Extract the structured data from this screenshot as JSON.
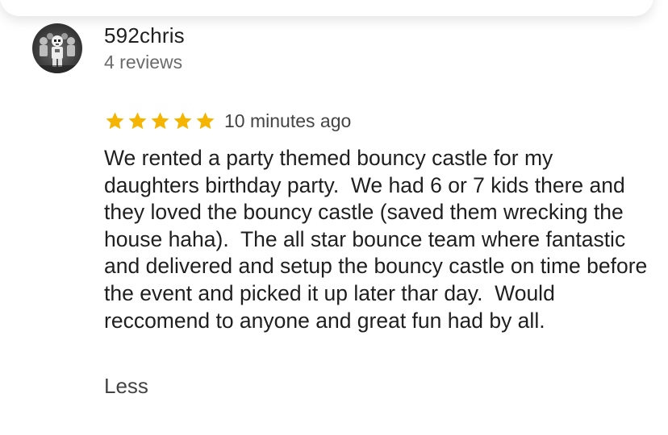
{
  "review": {
    "author_name": "592chris",
    "review_count": "4 reviews",
    "rating": 5,
    "rating_max": 5,
    "time_ago": "10 minutes ago",
    "body": "We rented a party themed bouncy castle for my daughters birthday party.  We had 6 or 7 kids there and they loved the bouncy castle (saved them wrecking the house haha).  The all star bounce team where fantastic and delivered and setup the bouncy castle on time before the event and picked it up later thar day.  Would reccomend to anyone and great fun had by all.",
    "less_label": "Less"
  },
  "colors": {
    "star": "#f4b400",
    "text": "#1f1f1f",
    "muted": "#6b6b6b"
  },
  "icons": {
    "avatar": "stormtrooper-avatar-icon",
    "star": "star-icon"
  }
}
